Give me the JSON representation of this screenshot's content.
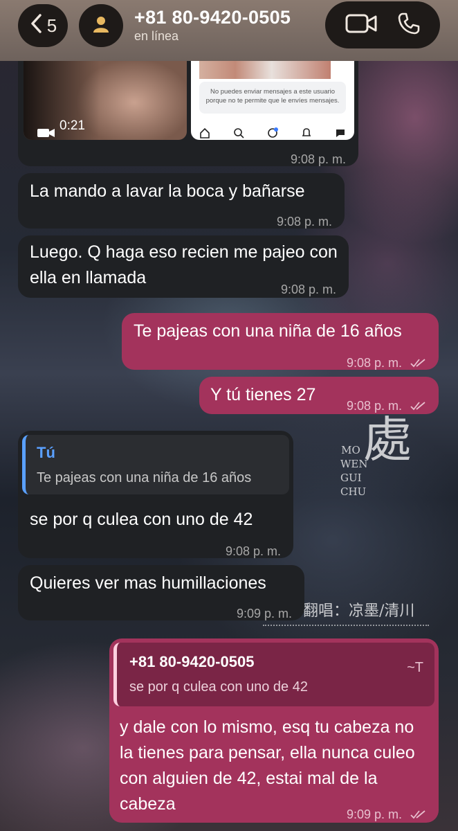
{
  "header": {
    "back_count": "5",
    "contact_name": "+81 80-9420-0505",
    "status": "en línea"
  },
  "media_message": {
    "video_duration": "0:21",
    "screenshot_notice": "No puedes enviar mensajes a este usuario porque no te permite que le envíes mensajes.",
    "time": "9:08 p. m."
  },
  "messages": [
    {
      "id": "m1",
      "text": "La mando a lavar la boca y bañarse",
      "time": "9:08 p. m."
    },
    {
      "id": "m2",
      "text": "Luego. Q haga eso recien me pajeo con ella en llamada",
      "time": "9:08 p. m."
    },
    {
      "id": "m3",
      "text": "Te pajeas con una niña de 16 años",
      "time": "9:08 p. m."
    },
    {
      "id": "m4",
      "text": "Y tú tienes 27",
      "time": "9:08 p. m."
    },
    {
      "id": "m5",
      "reply_author": "Tú",
      "reply_text": "Te pajeas con una niña de 16 años",
      "text": "se por q culea con uno de 42",
      "time": "9:08 p. m."
    },
    {
      "id": "m6",
      "text": "Quieres ver mas humillaciones",
      "time": "9:09 p. m."
    },
    {
      "id": "m7",
      "reply_author": "+81 80-9420-0505",
      "reply_tag": "~T",
      "reply_text": "se por q culea con uno de 42",
      "text": "y dale con lo mismo, esq tu cabeza no la tienes para pensar, ella nunca culeo con alguien de 42, estai mal de la cabeza",
      "time": "9:09 p. m."
    }
  ],
  "wallpaper_text": {
    "v1": "MO",
    "v2": "WEN",
    "v3": "GUI",
    "v4": "CHU",
    "chars": "處",
    "credit": "翻唱：凉墨/清川"
  },
  "colors": {
    "incoming": "#1f2124",
    "outgoing": "#a3335c",
    "reply_accent_in": "#5aa0ff"
  }
}
